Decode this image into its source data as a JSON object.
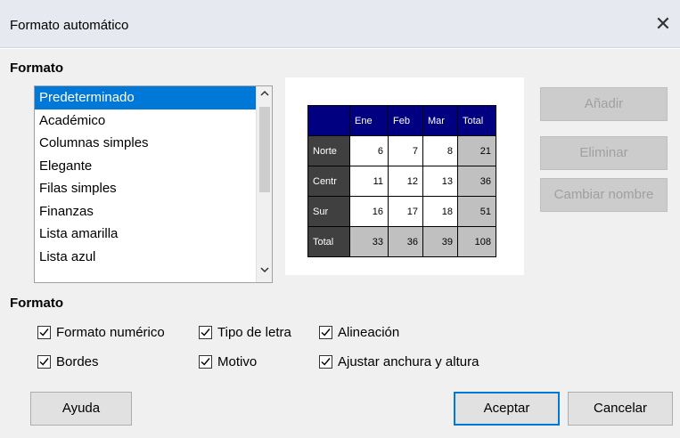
{
  "window": {
    "title": "Formato automático",
    "close_glyph": "✕"
  },
  "format_section": {
    "label": "Formato",
    "list": {
      "items": [
        "Predeterminado",
        "Académico",
        "Columnas simples",
        "Elegante",
        "Filas simples",
        "Finanzas",
        "Lista amarilla",
        "Lista azul"
      ],
      "selected_index": 0
    }
  },
  "preview": {
    "header": [
      "",
      "Ene",
      "Feb",
      "Mar",
      "Total"
    ],
    "rows": [
      [
        "Norte",
        "6",
        "7",
        "8",
        "21"
      ],
      [
        "Centr",
        "11",
        "12",
        "13",
        "36"
      ],
      [
        "Sur",
        "16",
        "17",
        "18",
        "51"
      ],
      [
        "Total",
        "33",
        "36",
        "39",
        "108"
      ]
    ],
    "colors": {
      "header_bg": "#000080",
      "row_header_bg": "#404040",
      "total_bg": "#c0c0c0"
    }
  },
  "side_buttons": {
    "add": "Añadir",
    "delete": "Eliminar",
    "rename": "Cambiar nombre"
  },
  "options_section": {
    "label": "Formato",
    "checkboxes": {
      "number_format": {
        "label": "Formato numérico",
        "checked": true
      },
      "font": {
        "label": "Tipo de letra",
        "checked": true
      },
      "alignment": {
        "label": "Alineación",
        "checked": true
      },
      "borders": {
        "label": "Bordes",
        "checked": true
      },
      "pattern": {
        "label": "Motivo",
        "checked": true
      },
      "autofit": {
        "label": "Ajustar anchura y altura",
        "checked": true
      }
    }
  },
  "footer": {
    "help": "Ayuda",
    "ok": "Aceptar",
    "cancel": "Cancelar"
  },
  "accent_color": "#0078d7"
}
